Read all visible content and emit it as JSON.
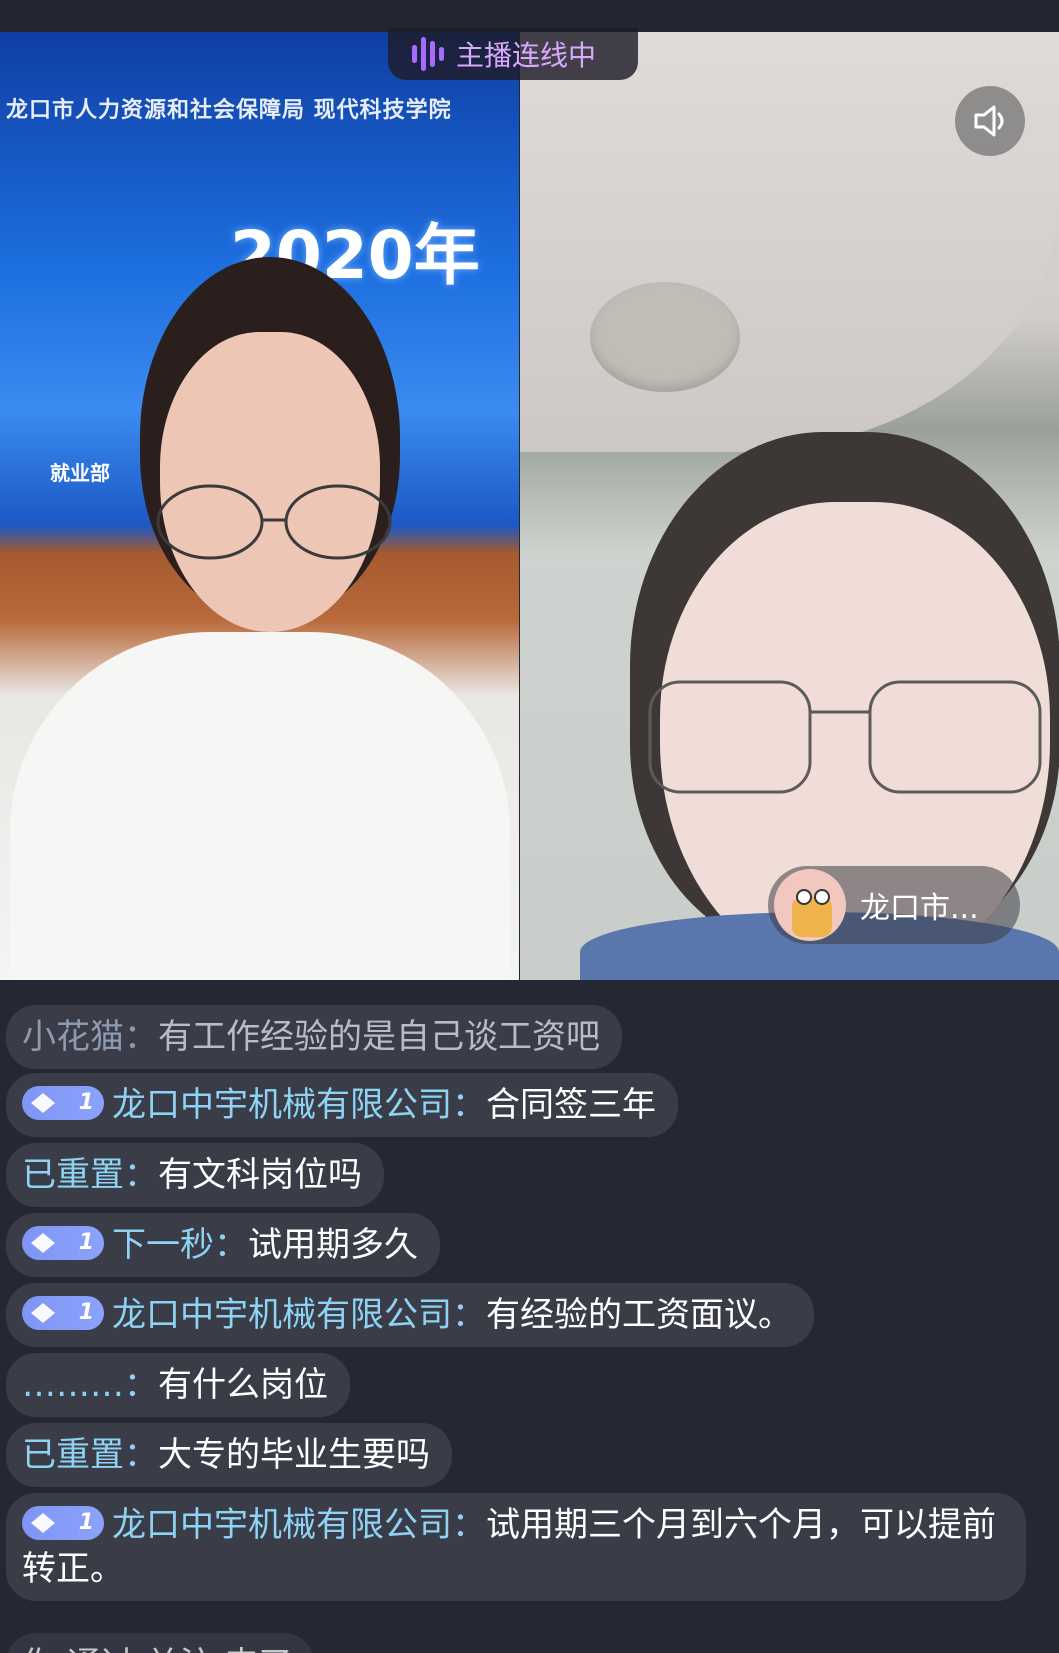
{
  "live": {
    "connect_status": "主播连线中",
    "left_banner_line1": "龙口市人力资源和社会保障局 现代科技学院",
    "left_banner_year": "2020年",
    "left_banner_dept": "就业部",
    "guest_name": "龙口市..."
  },
  "colors": {
    "accent_purple": "#a86bff",
    "username_blue": "#8fd3f4",
    "badge_blue": "#8aa3fb"
  },
  "icons": {
    "connect": "sound-wave-icon",
    "speaker": "speaker-icon",
    "fan_badge": "diamond-icon"
  },
  "chat": {
    "messages": [
      {
        "user": "小花猫",
        "sep": "：",
        "text": "有工作经验的是自己谈工资吧",
        "badge": ""
      },
      {
        "user": "龙口中宇机械有限公司",
        "sep": "：",
        "text": "合同签三年",
        "badge": "1"
      },
      {
        "user": "已重置",
        "sep": "：",
        "text": "有文科岗位吗",
        "badge": ""
      },
      {
        "user": "下一秒",
        "sep": "：",
        "text": "试用期多久",
        "badge": "1"
      },
      {
        "user": "龙口中宇机械有限公司",
        "sep": "：",
        "text": "有经验的工资面议。",
        "badge": "1"
      },
      {
        "user": "………",
        "sep": "：",
        "text": "有什么岗位",
        "badge": ""
      },
      {
        "user": "已重置",
        "sep": "：",
        "text": "大专的毕业生要吗",
        "badge": ""
      },
      {
        "user": "龙口中宇机械有限公司",
        "sep": "：",
        "text": "试用期三个月到六个月，可以提前转正。",
        "badge": "1"
      },
      {
        "user": "",
        "sep": "",
        "text": "你 通过 关注 来了",
        "badge": ""
      }
    ]
  }
}
